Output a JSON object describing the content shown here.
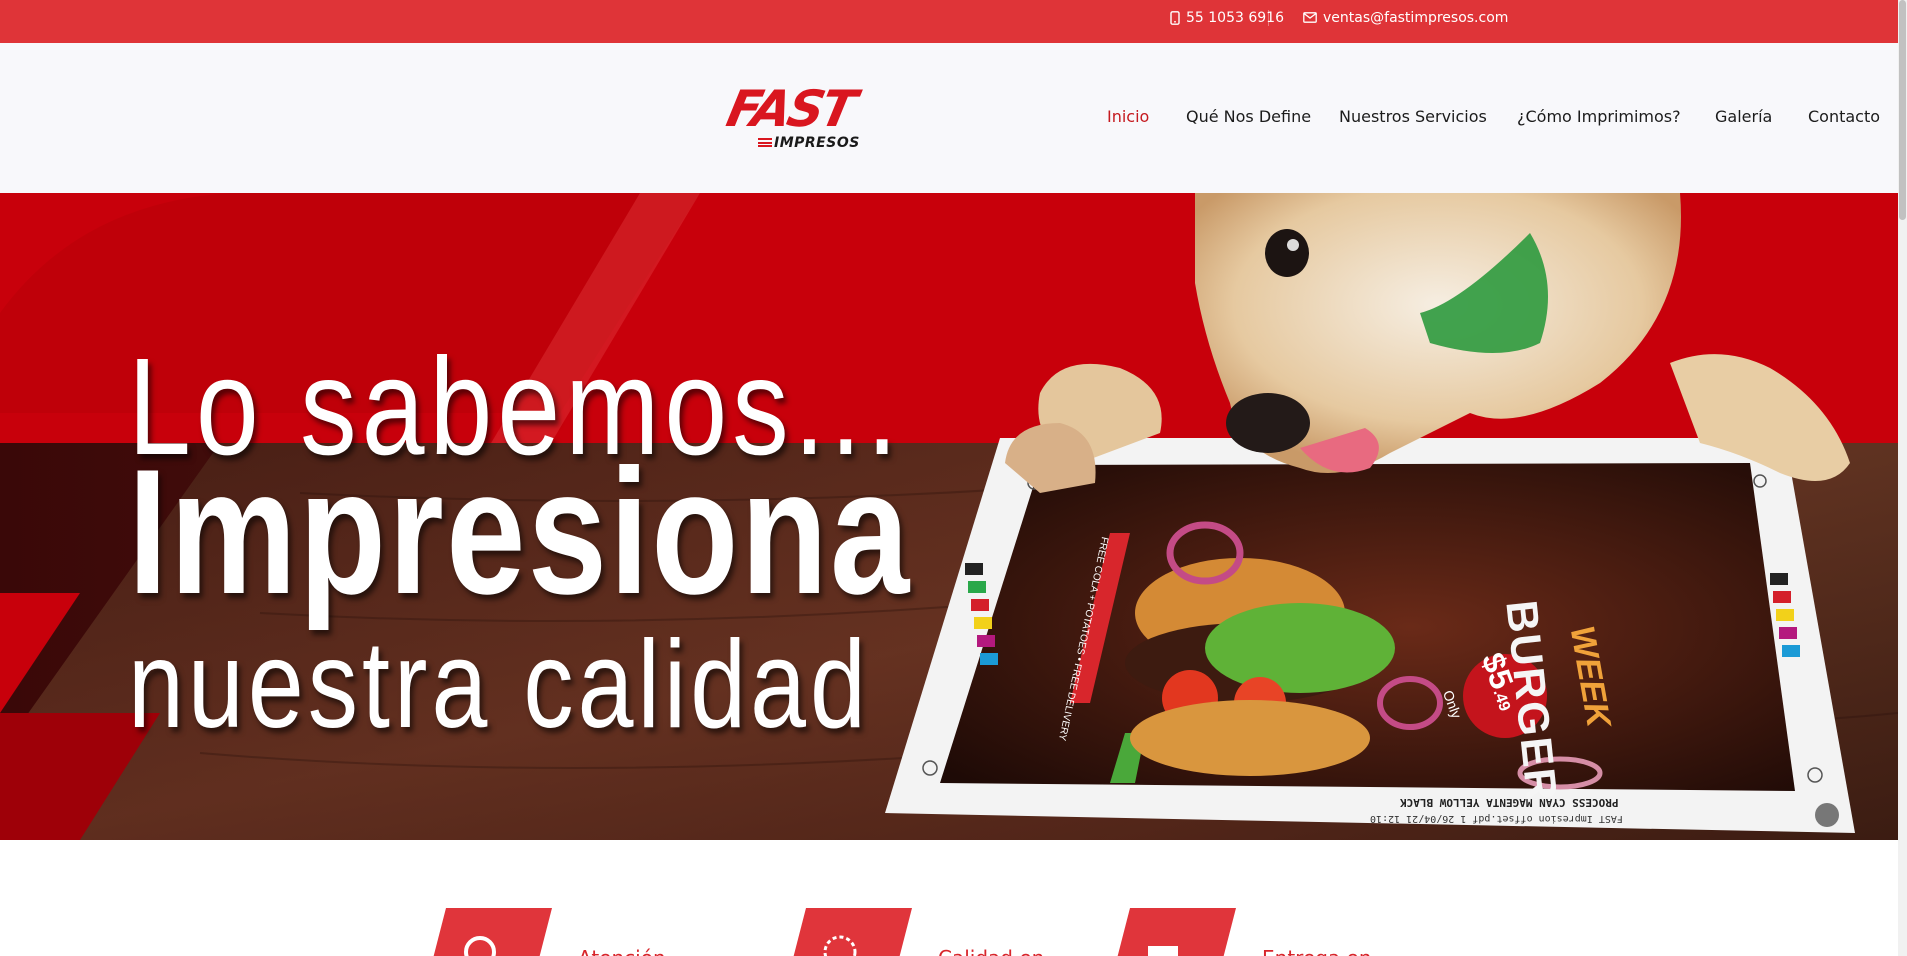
{
  "topbar": {
    "phone": "55 1053 6916",
    "email": "ventas@fastimpresos.com",
    "phone_icon": "mobile-phone-icon",
    "email_icon": "envelope-icon"
  },
  "logo": {
    "main": "FAST",
    "sub": "IMPRESOS"
  },
  "nav": {
    "items": [
      {
        "label": "Inicio",
        "active": true
      },
      {
        "label": "Qué Nos Define",
        "active": false
      },
      {
        "label": "Nuestros Servicios",
        "active": false
      },
      {
        "label": "¿Cómo Imprimimos?",
        "active": false
      },
      {
        "label": "Galería",
        "active": false
      },
      {
        "label": "Contacto",
        "active": false
      }
    ]
  },
  "hero": {
    "line1": "Lo sabemos...",
    "line2": "Impresiona",
    "line3": "nuestra calidad",
    "flyer": {
      "title1": "BURGER",
      "title2": "WEEK",
      "price": "$5",
      "price_cents": ".49",
      "price_note": "Only",
      "strip": "PROCESS CYAN MAGENTA YELLOW BLACK",
      "file": "FAST Impresion offset.pdf   1   26/04/21   12:10",
      "promo": "FREE COLA + POTATOES • FREE DELIVERY"
    }
  },
  "features": {
    "items": [
      {
        "label": "Atención",
        "icon": "headset-icon"
      },
      {
        "label": "Calidad en",
        "icon": "quality-seal-icon"
      },
      {
        "label": "Entrega en",
        "icon": "delivery-icon"
      }
    ]
  },
  "colors": {
    "brand_red": "#df3438",
    "nav_active": "#c51a1f",
    "hero_red": "#c8000b"
  }
}
